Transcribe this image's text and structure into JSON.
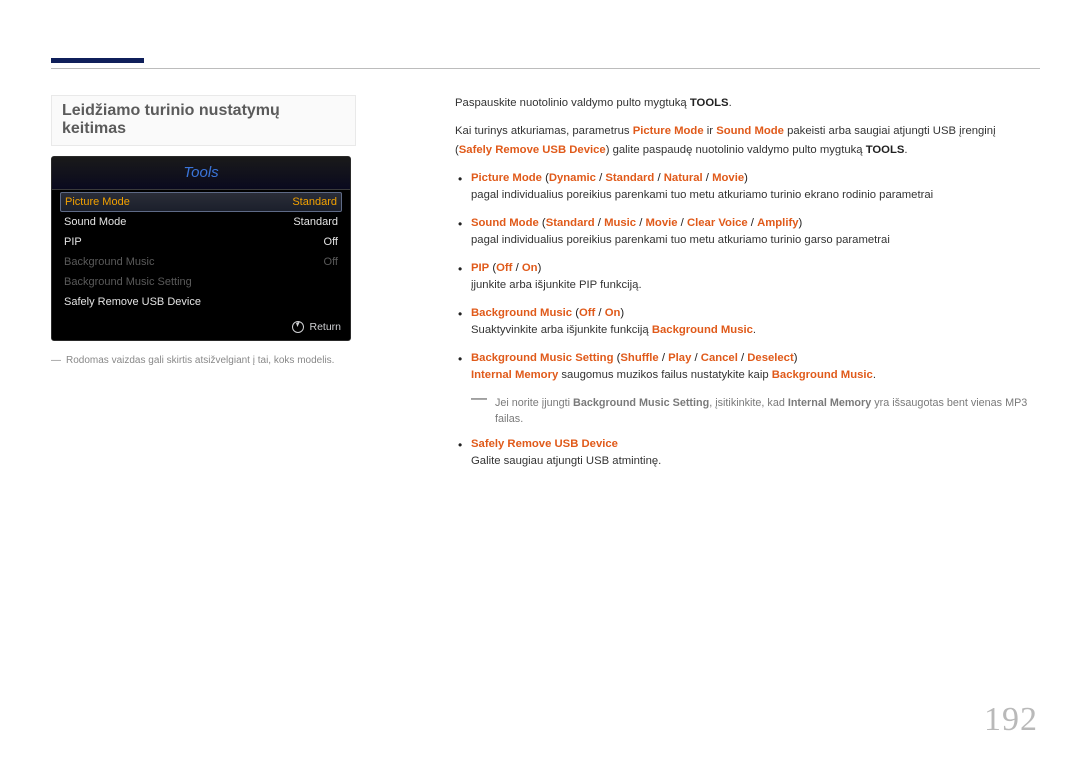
{
  "page_number": "192",
  "left": {
    "title": "Leidžiamo turinio nustatymų keitimas",
    "footnote_dash": "―",
    "footnote": "Rodomas vaizdas gali skirtis atsižvelgiant į tai, koks modelis."
  },
  "tv": {
    "title": "Tools",
    "rows": {
      "r0": {
        "label": "Picture Mode",
        "value": "Standard"
      },
      "r1": {
        "label": "Sound Mode",
        "value": "Standard"
      },
      "r2": {
        "label": "PIP",
        "value": "Off"
      },
      "r3": {
        "label": "Background Music",
        "value": "Off"
      },
      "r4": {
        "label": "Background Music Setting",
        "value": ""
      },
      "r5": {
        "label": "Safely Remove USB Device",
        "value": ""
      }
    },
    "return": "Return"
  },
  "right": {
    "intro1_a": "Paspauskite nuotolinio valdymo pulto mygtuką ",
    "intro1_b": "TOOLS",
    "intro1_c": ".",
    "intro2_a": "Kai turinys atkuriamas, parametrus ",
    "intro2_b": "Picture Mode",
    "intro2_c": " ir ",
    "intro2_d": "Sound Mode",
    "intro2_e": " pakeisti arba saugiai atjungti USB įrenginį",
    "intro3_a": "(",
    "intro3_b": "Safely Remove USB Device",
    "intro3_c": ") galite paspaudę nuotolinio valdymo pulto mygtuką ",
    "intro3_d": "TOOLS",
    "intro3_e": ".",
    "b1": {
      "t1": "Picture Mode",
      "t2": " (",
      "t3": "Dynamic",
      "t4": " / ",
      "t5": "Standard",
      "t6": " / ",
      "t7": "Natural",
      "t8": " / ",
      "t9": "Movie",
      "t10": ")",
      "sub": "pagal individualius poreikius parenkami tuo metu atkuriamo turinio ekrano rodinio parametrai"
    },
    "b2": {
      "t1": "Sound Mode",
      "t2": " (",
      "t3": "Standard",
      "t4": " / ",
      "t5": "Music",
      "t6": " / ",
      "t7": "Movie",
      "t8": " / ",
      "t9": "Clear Voice",
      "t10": " / ",
      "t11": "Amplify",
      "t12": ")",
      "sub": "pagal individualius poreikius parenkami tuo metu atkuriamo turinio garso parametrai"
    },
    "b3": {
      "t1": "PIP",
      "t2": " (",
      "t3": "Off",
      "t4": " / ",
      "t5": "On",
      "t6": ")",
      "sub": "įjunkite arba išjunkite PIP funkciją."
    },
    "b4": {
      "t1": "Background Music",
      "t2": " (",
      "t3": "Off",
      "t4": " / ",
      "t5": "On",
      "t6": ")",
      "sub_a": "Suaktyvinkite arba išjunkite funkciją ",
      "sub_b": "Background Music",
      "sub_c": "."
    },
    "b5": {
      "t1": "Background Music Setting",
      "t2": " (",
      "t3": "Shuffle",
      "t4": " / ",
      "t5": "Play",
      "t6": " / ",
      "t7": "Cancel",
      "t8": " / ",
      "t9": "Deselect",
      "t10": ")",
      "sub_a": "Internal Memory",
      "sub_b": " saugomus muzikos failus nustatykite kaip ",
      "sub_c": "Background Music",
      "sub_d": "."
    },
    "b5_note": {
      "dash": "―",
      "a": "Jei norite įjungti ",
      "b": "Background Music Setting",
      "c": ", įsitikinkite, kad ",
      "d": "Internal Memory",
      "e": " yra išsaugotas bent vienas MP3 failas."
    },
    "b6": {
      "t1": "Safely Remove USB Device",
      "sub": "Galite saugiau atjungti USB atmintinę."
    }
  }
}
